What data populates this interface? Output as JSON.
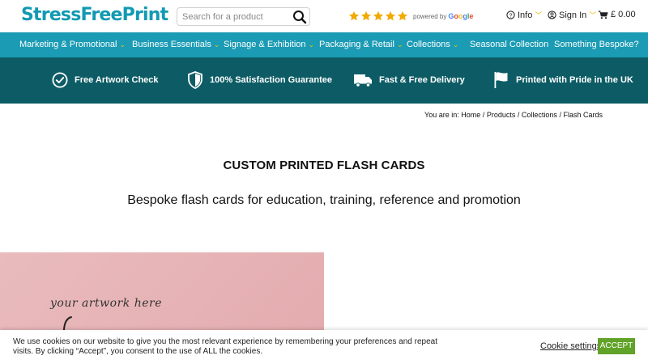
{
  "header": {
    "logo": "StressFreePrint",
    "search_placeholder": "Search for a product",
    "rating": {
      "stars": 5,
      "powered_by": "powered by",
      "provider": "Google"
    },
    "info_label": "Info",
    "signin_label": "Sign In",
    "cart_label": "£ 0.00"
  },
  "nav": {
    "items": [
      {
        "label": "Marketing & Promotional",
        "has_dropdown": true
      },
      {
        "label": "Business Essentials",
        "has_dropdown": true
      },
      {
        "label": "Signage & Exhibition",
        "has_dropdown": true
      },
      {
        "label": "Packaging & Retail",
        "has_dropdown": true
      },
      {
        "label": "Collections",
        "has_dropdown": true
      },
      {
        "label": "Seasonal Collection",
        "has_dropdown": false
      },
      {
        "label": "Something Bespoke?",
        "has_dropdown": false
      }
    ]
  },
  "usp": [
    {
      "icon": "check-circle-icon",
      "label": "Free Artwork Check"
    },
    {
      "icon": "shield-icon",
      "label": "100% Satisfaction Guarantee"
    },
    {
      "icon": "truck-icon",
      "label": "Fast & Free Delivery"
    },
    {
      "icon": "flag-icon",
      "label": "Printed with Pride in the UK"
    }
  ],
  "breadcrumb": {
    "prefix": "You are in:",
    "items": [
      "Home",
      "Products",
      "Collections",
      "Flash Cards"
    ],
    "separator": "/"
  },
  "page": {
    "title": "CUSTOM PRINTED FLASH CARDS",
    "subtitle": "Bespoke flash cards for education, training, reference and promotion",
    "artwork_text": "your artwork here"
  },
  "cookie": {
    "text": "We use cookies on our website to give you the most relevant experience by remembering your preferences and repeat visits. By clicking “Accept”, you consent to the use of ALL the cookies.",
    "settings_label": "Cookie settings",
    "accept_label": "ACCEPT"
  },
  "colors": {
    "brand": "#1b9bb4",
    "usp_band": "#0d5c65",
    "star": "#f2a900",
    "accept": "#61a229"
  }
}
